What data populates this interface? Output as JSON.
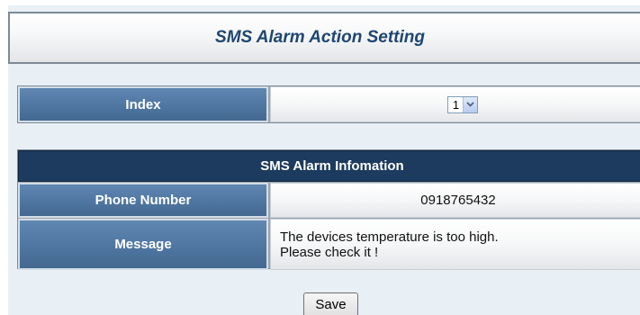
{
  "page": {
    "title": "SMS Alarm Action Setting"
  },
  "index": {
    "label": "Index",
    "selected": "1",
    "icon": "chevron-down-icon"
  },
  "sms_info": {
    "section_title": "SMS Alarm Infomation",
    "phone_label": "Phone Number",
    "phone_value": "0918765432",
    "message_label": "Message",
    "message_lines": [
      "The devices temperature is too high.",
      "Please check it !"
    ]
  },
  "actions": {
    "save_label": "Save"
  },
  "colors": {
    "header_blue": "#4f76a1",
    "section_navy": "#1d3b5e",
    "title_text": "#1f4670",
    "panel_bg": "#e8f0f6"
  }
}
